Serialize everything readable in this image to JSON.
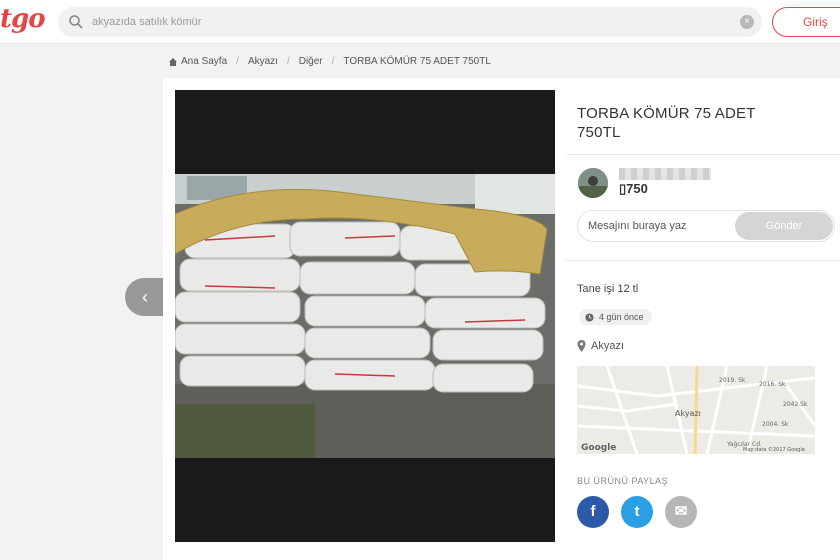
{
  "header": {
    "logo": "tgo",
    "search_placeholder": "akyazıda satılık kömür",
    "clear_glyph": "×",
    "login_label": "Giriş"
  },
  "breadcrumb": [
    "Ana Sayfa",
    "Akyazı",
    "Diğer",
    "TORBA KÖMÜR 75 ADET 750TL"
  ],
  "listing": {
    "title": "TORBA KÖMÜR 75 ADET 750TL",
    "price": "▯750",
    "description": "Tane işi 12 tl",
    "posted": "4 gün önce",
    "location": "Akyazı",
    "prev_arrow": "‹"
  },
  "seller": {
    "name": ""
  },
  "message": {
    "placeholder": "Mesajını buraya yaz",
    "send_label": "Gönder"
  },
  "map": {
    "streets": [
      "2019. Sk",
      "2016. Sk",
      "2004. Sk",
      "2042.Sk",
      "Yağcılar Cd."
    ],
    "town_label": "Akyazı",
    "brand": "Google",
    "credit": "Map data ©2017 Google"
  },
  "share": {
    "label": "BU ÜRÜNÜ PAYLAŞ",
    "facebook_glyph": "f",
    "twitter_glyph": "t",
    "email_glyph": "✉"
  },
  "colors": {
    "brand": "#e64545",
    "facebook": "#2d5aa8",
    "twitter": "#2b9fe6"
  }
}
